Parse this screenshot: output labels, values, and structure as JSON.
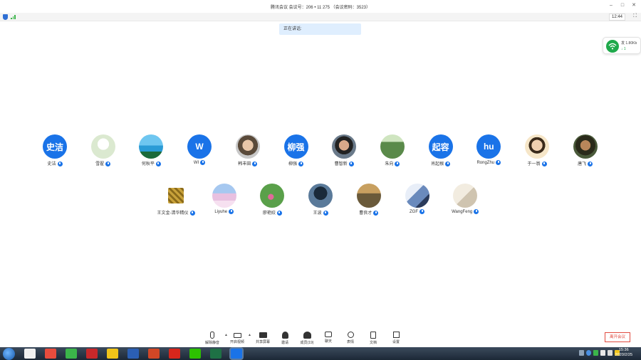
{
  "window": {
    "title": "腾讯会议  会议号：206 • 11 275   （会议密码：3523）",
    "controls": [
      "–",
      "□",
      "✕"
    ]
  },
  "infobar": {
    "timer": "12:44",
    "fullscreen_icon": "fullscreen-icon"
  },
  "speaking": {
    "label": "正在讲话:"
  },
  "network": {
    "speed": "发 1.80Kb",
    "sub": "↓ 1"
  },
  "participants_row1": [
    {
      "name": "史洁",
      "initial": "史洁",
      "avatar": "initial",
      "color": "#1a73e8"
    },
    {
      "name": "雪翟",
      "initial": "",
      "avatar": "cartoon-girl",
      "color": "#9ccf78"
    },
    {
      "name": "何秋平",
      "initial": "",
      "avatar": "beach-palms",
      "color": "#2a9bd6"
    },
    {
      "name": "WI",
      "initial": "W",
      "avatar": "initial",
      "color": "#1a73e8"
    },
    {
      "name": "韩丰田",
      "initial": "",
      "avatar": "man-glasses",
      "color": "#8a7a6a"
    },
    {
      "name": "柳强",
      "initial": "柳强",
      "avatar": "initial",
      "color": "#1a73e8"
    },
    {
      "name": "曹智新",
      "initial": "",
      "avatar": "man-portrait",
      "color": "#3a2f2a"
    },
    {
      "name": "朱向",
      "initial": "",
      "avatar": "green-field",
      "color": "#6a9a5a"
    },
    {
      "name": "肖起根",
      "initial": "起容",
      "avatar": "initial",
      "color": "#1a73e8"
    },
    {
      "name": "RongZhu",
      "initial": "hu",
      "avatar": "initial",
      "color": "#1a73e8"
    },
    {
      "name": "于一翁",
      "initial": "",
      "avatar": "woman-portrait",
      "color": "#e6c59a"
    },
    {
      "name": "唐飞",
      "initial": "",
      "avatar": "man-dark",
      "color": "#4a3a2a"
    }
  ],
  "participants_row2": [
    {
      "name": "王文金-清华精仪",
      "initial": "",
      "avatar": "qr-pattern",
      "color": "#c9a23a"
    },
    {
      "name": "Liyuhe",
      "initial": "",
      "avatar": "pink-sky",
      "color": "#c7b8e6"
    },
    {
      "name": "廖艳姣",
      "initial": "",
      "avatar": "flowers",
      "color": "#5aa04a"
    },
    {
      "name": "王波",
      "initial": "",
      "avatar": "tree-night",
      "color": "#2a3a5a"
    },
    {
      "name": "曹良才",
      "initial": "",
      "avatar": "grass-field",
      "color": "#6a5a3a"
    },
    {
      "name": "ZGF",
      "initial": "",
      "avatar": "snow-peak",
      "color": "#6a8abc"
    },
    {
      "name": "WangFeng",
      "initial": "",
      "avatar": "sketch",
      "color": "#d8d0c0"
    }
  ],
  "toolbar": {
    "items": [
      {
        "label": "解除静音",
        "icon": "mic-muted-icon"
      },
      {
        "label": "开启视频",
        "icon": "camera-off-icon"
      },
      {
        "label": "共享屏幕",
        "icon": "screen-share-icon"
      },
      {
        "label": "邀请",
        "icon": "invite-icon"
      },
      {
        "label": "成员(19)",
        "icon": "members-icon"
      },
      {
        "label": "聊天",
        "icon": "chat-icon"
      },
      {
        "label": "表情",
        "icon": "emoji-icon"
      },
      {
        "label": "文档",
        "icon": "document-icon"
      },
      {
        "label": "设置",
        "icon": "settings-icon"
      }
    ],
    "end_label": "离开会议"
  },
  "taskbar": {
    "apps": [
      "explorer",
      "tiles",
      "browser",
      "car-app",
      "folder",
      "word",
      "powerpoint",
      "pdf",
      "wechat",
      "excel",
      "tencent-meeting"
    ],
    "time": "15:36",
    "date": "2020/2/25"
  }
}
